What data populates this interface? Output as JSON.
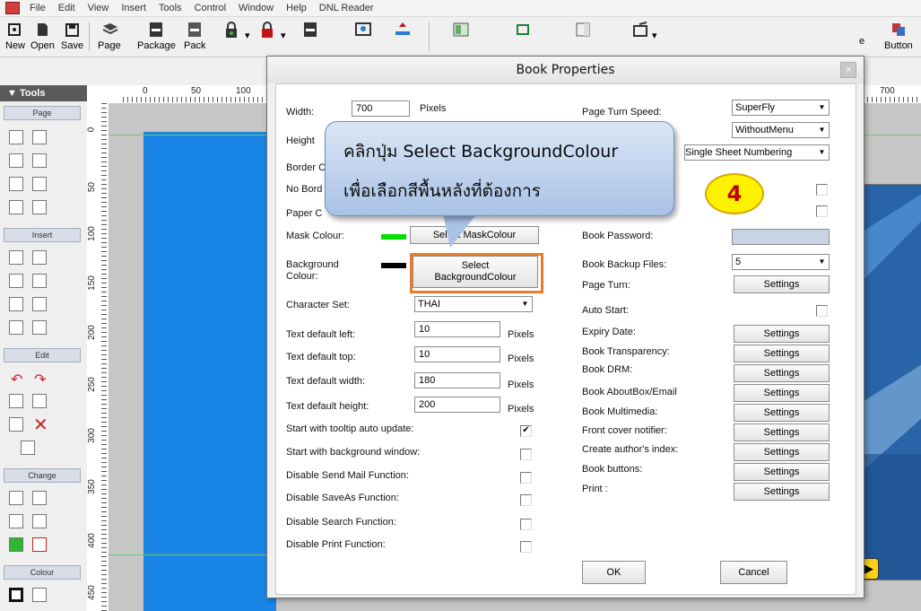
{
  "menubar": {
    "items": [
      "File",
      "Edit",
      "View",
      "Insert",
      "Tools",
      "Control",
      "Window",
      "Help",
      "DNL Reader"
    ]
  },
  "toolbar": {
    "buttons": [
      "New",
      "Open",
      "Save",
      "Page",
      "Package",
      "Pack",
      "e",
      "Button"
    ]
  },
  "tools_panel": {
    "title": "▼ Tools",
    "sections": [
      "Page",
      "Insert",
      "Edit",
      "Change",
      "Colour"
    ]
  },
  "ruler": {
    "h_ticks": [
      "0",
      "50",
      "100",
      "700"
    ],
    "v_ticks": [
      "0",
      "50",
      "100",
      "150",
      "200",
      "250",
      "300",
      "350",
      "400",
      "450"
    ]
  },
  "dialog": {
    "title": "Book Properties",
    "close": "×",
    "left": {
      "width_label": "Width:",
      "width_value": "700",
      "width_unit": "Pixels",
      "height_label": "Height",
      "border_label": "Border C",
      "noborder_label": "No Bord",
      "paper_label": "Paper C",
      "mask_label": "Mask Colour:",
      "mask_button": "Select MaskColour",
      "bg_label_1": "Background",
      "bg_label_2": "Colour:",
      "bg_button_1": "Select",
      "bg_button_2": "BackgroundColour",
      "charset_label": "Character Set:",
      "charset_value": "THAI",
      "text_left_label": "Text default left:",
      "text_left_value": "10",
      "text_top_label": "Text default top:",
      "text_top_value": "10",
      "text_width_label": "Text default width:",
      "text_width_value": "180",
      "text_height_label": "Text default height:",
      "text_height_value": "200",
      "pixels": "Pixels",
      "tooltip_label": "Start with tooltip auto update:",
      "tooltip_check": "✔",
      "bgwindow_label": "Start with background window:",
      "sendmail_label": "Disable Send Mail Function:",
      "saveas_label": "Disable SaveAs Function:",
      "search_label": "Disable Search Function:",
      "print_label": "Disable Print Function:",
      "ok_button": "OK"
    },
    "right": {
      "turn_speed_label": "Page Turn Speed:",
      "turn_speed_value": "SuperFly",
      "menu_value": "WithoutMenu",
      "numbering_value": "Single Sheet Numbering",
      "password_label": "Book Password:",
      "backup_label": "Book Backup Files:",
      "backup_value": "5",
      "page_turn_label": "Page Turn:",
      "auto_start_label": "Auto Start:",
      "expiry_label": "Expiry Date:",
      "transparency_label": "Book Transparency:",
      "drm_label": "Book DRM:",
      "aboutbox_label": "Book AboutBox/Email",
      "multimedia_label": "Book Multimedia:",
      "front_cover_label": "Front cover notifier:",
      "author_index_label": "Create author's index:",
      "buttons_label": "Book buttons:",
      "print_label": "Print :",
      "settings": "Settings",
      "cancel_button": "Cancel"
    }
  },
  "callout": {
    "line1": "คลิกปุ่ม Select BackgroundColour",
    "line2": "เพื่อเลือกสีพื้นหลังที่ต้องการ"
  },
  "step_badge": "4",
  "colors": {
    "mask": "#00e000",
    "background": "#000000",
    "page_blue": "#1a85e8",
    "highlight": "#ec7a2a",
    "badge": "#fff200"
  }
}
